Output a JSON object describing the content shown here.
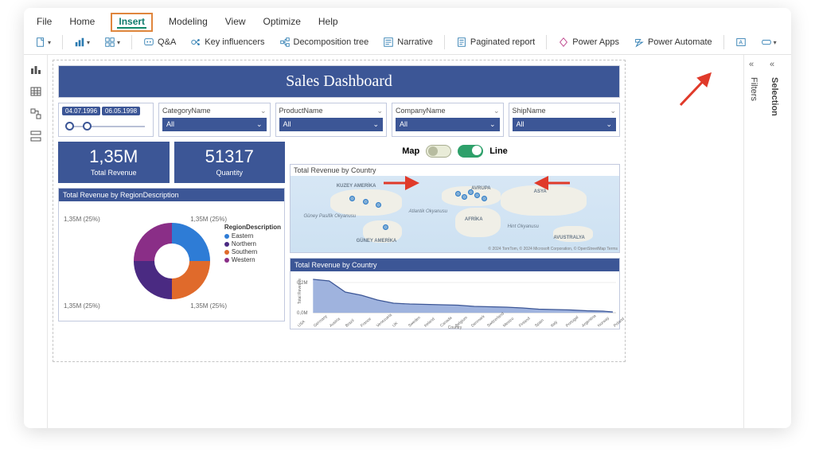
{
  "menu": {
    "tabs": [
      "File",
      "Home",
      "Insert",
      "Modeling",
      "View",
      "Optimize",
      "Help"
    ],
    "active_index": 2
  },
  "ribbon": {
    "groups": [
      {
        "icon": "page",
        "label": "",
        "dropdown": true
      },
      {
        "icon": "visual",
        "label": "",
        "dropdown": true
      },
      {
        "icon": "more",
        "label": "",
        "dropdown": true
      },
      {
        "icon": "qa",
        "label": "Q&A"
      },
      {
        "icon": "ki",
        "label": "Key influencers"
      },
      {
        "icon": "tree",
        "label": "Decomposition tree"
      },
      {
        "icon": "narr",
        "label": "Narrative"
      },
      {
        "icon": "pag",
        "label": "Paginated report"
      },
      {
        "icon": "pa",
        "label": "Power Apps"
      },
      {
        "icon": "paut",
        "label": "Power Automate"
      },
      {
        "icon": "txt",
        "label": "",
        "small": true
      },
      {
        "icon": "btn",
        "label": "",
        "dropdown": true,
        "small": true
      },
      {
        "icon": "shp",
        "label": "",
        "dropdown": true,
        "small": true
      },
      {
        "icon": "img",
        "label": "",
        "small": true
      }
    ]
  },
  "right_panes": {
    "collapse_glyph": "«",
    "tabs": [
      "Filters",
      "Selection"
    ]
  },
  "report": {
    "title": "Sales Dashboard",
    "date_slicer": {
      "from": "04.07.1996",
      "to": "06.05.1998"
    },
    "slicers": [
      {
        "header": "CategoryName",
        "value": "All"
      },
      {
        "header": "ProductName",
        "value": "All"
      },
      {
        "header": "CompanyName",
        "value": "All"
      },
      {
        "header": "ShipName",
        "value": "All"
      }
    ],
    "kpis": [
      {
        "value": "1,35M",
        "label": "Total Revenue"
      },
      {
        "value": "51317",
        "label": "Quantity"
      }
    ],
    "donut": {
      "title": "Total Revenue by RegionDescription",
      "legend_title": "RegionDescription",
      "segments": [
        {
          "name": "Eastern",
          "label": "1,35M (25%)",
          "color": "#2e7cd6"
        },
        {
          "name": "Northern",
          "label": "1,35M (25%)",
          "color": "#4a2a82"
        },
        {
          "name": "Southern",
          "label": "1,35M (25%)",
          "color": "#e06a2b"
        },
        {
          "name": "Western",
          "label": "1,35M (25%)",
          "color": "#8a2e87"
        }
      ]
    },
    "toggles": {
      "map_label": "Map",
      "line_label": "Line",
      "map_on": false,
      "line_on": true
    },
    "map": {
      "title": "Total Revenue by Country",
      "labels": [
        "KUZEY AMERİKA",
        "GÜNEY AMERİKA",
        "AVRUPA",
        "AFRİKA",
        "ASYA",
        "AVUSTRALYA",
        "Atlantik Okyanusu",
        "Hint Okyanusu",
        "Güney Pasifik Okyanusu"
      ],
      "attrib": "© 2024 TomTom, © 2024 Microsoft Corporation, © OpenStreetMap  Terms"
    },
    "line": {
      "title": "Total Revenue by Country",
      "ylabel": "Total Revenue",
      "xlabel": "Country"
    }
  },
  "chart_data": [
    {
      "type": "pie",
      "title": "Total Revenue by RegionDescription",
      "series": [
        {
          "name": "Eastern",
          "value": 1350000,
          "pct": 25
        },
        {
          "name": "Northern",
          "value": 1350000,
          "pct": 25
        },
        {
          "name": "Southern",
          "value": 1350000,
          "pct": 25
        },
        {
          "name": "Western",
          "value": 1350000,
          "pct": 25
        }
      ]
    },
    {
      "type": "line",
      "title": "Total Revenue by Country",
      "xlabel": "Country",
      "ylabel": "Total Revenue",
      "ylim": [
        0,
        250000
      ],
      "yticks": [
        0,
        200000
      ],
      "ytick_labels": [
        "0,0M",
        "0,2M"
      ],
      "categories": [
        "USA",
        "Germany",
        "Austria",
        "Brazil",
        "France",
        "Venezuela",
        "UK",
        "Sweden",
        "Ireland",
        "Canada",
        "Belgium",
        "Denmark",
        "Switzerland",
        "Mexico",
        "Finland",
        "Spain",
        "Italy",
        "Portugal",
        "Argentina",
        "Norway",
        "Poland"
      ],
      "values": [
        240000,
        225000,
        135000,
        115000,
        85000,
        60000,
        58000,
        56000,
        52000,
        50000,
        40000,
        38000,
        35000,
        30000,
        22000,
        20000,
        18000,
        14000,
        10000,
        8000,
        5000
      ]
    }
  ]
}
